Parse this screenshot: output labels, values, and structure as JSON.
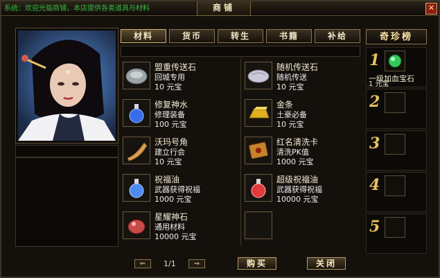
{
  "window": {
    "title": "商铺",
    "ticker": "系统：欢迎光临商铺，本店提供各类道具与材料"
  },
  "tabs": [
    {
      "label": "材料",
      "active": true
    },
    {
      "label": "货币",
      "active": false
    },
    {
      "label": "转生",
      "active": false
    },
    {
      "label": "书籍",
      "active": false
    },
    {
      "label": "补给",
      "active": false
    }
  ],
  "items": [
    {
      "name": "盟重传送石",
      "desc": "回城专用",
      "price": "10 元宝",
      "icon": "stone-icon",
      "color": "#9aa4a8"
    },
    {
      "name": "随机传送石",
      "desc": "随机传送",
      "price": "10 元宝",
      "icon": "stone-icon",
      "color": "#c8c8d8"
    },
    {
      "name": "修复神水",
      "desc": "修理装备",
      "price": "100 元宝",
      "icon": "potion-icon",
      "color": "#3a6ee8"
    },
    {
      "name": "金条",
      "desc": "土豪必备",
      "price": "10 元宝",
      "icon": "gold-bar-icon",
      "color": "#e0b020"
    },
    {
      "name": "沃玛号角",
      "desc": "建立行会",
      "price": "10 元宝",
      "icon": "horn-icon",
      "color": "#d8a050"
    },
    {
      "name": "红名清洗卡",
      "desc": "清洗PK值",
      "price": "1000 元宝",
      "icon": "card-icon",
      "color": "#c8842a"
    },
    {
      "name": "祝福油",
      "desc": "武器获得祝福",
      "price": "1000 元宝",
      "icon": "potion-icon",
      "color": "#4c8cf0"
    },
    {
      "name": "超级祝福油",
      "desc": "武器获得祝福",
      "price": "10000 元宝",
      "icon": "potion-icon",
      "color": "#e03a3a"
    },
    {
      "name": "星耀神石",
      "desc": "通用材料",
      "price": "10000 元宝",
      "icon": "gem-stone-icon",
      "color": "#c84a4a"
    }
  ],
  "pager": {
    "text": "1/1"
  },
  "buttons": {
    "buy": "购买",
    "close": "关闭"
  },
  "ranking": {
    "title": "奇珍榜",
    "entries": [
      {
        "rank": "1",
        "name": "一级加血宝石",
        "price": "1 元宝",
        "color": "#33c85a"
      },
      {
        "rank": "2",
        "name": "",
        "price": ""
      },
      {
        "rank": "3",
        "name": "",
        "price": ""
      },
      {
        "rank": "4",
        "name": "",
        "price": ""
      },
      {
        "rank": "5",
        "name": "",
        "price": ""
      }
    ]
  },
  "colors": {
    "frame": "#8a7650",
    "accent": "#e8c35d",
    "text": "#f3ead2"
  }
}
